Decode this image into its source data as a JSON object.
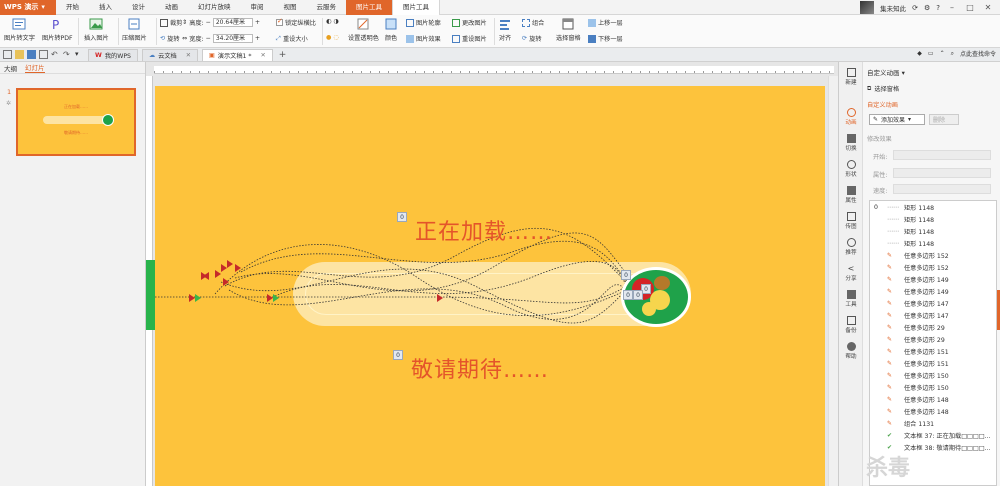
{
  "app": {
    "name": "WPS 演示"
  },
  "menu": {
    "tabs": [
      "开始",
      "插入",
      "设计",
      "动画",
      "幻灯片放映",
      "审阅",
      "视图",
      "云服务",
      "图片工具",
      "图片工具"
    ],
    "user": "集未知此",
    "window_controls": [
      "–",
      "□",
      "✕"
    ]
  },
  "ribbon": {
    "pic_to_text": "图片转文字",
    "pic_to_pdf": "图片转PDF",
    "insert_pic": "插入图片",
    "compress": "压缩图片",
    "crop": "裁剪",
    "rotate": "旋转",
    "height_label": "高度:",
    "height_value": "20.64厘米",
    "width_label": "宽度:",
    "width_value": "34.20厘米",
    "lock_ratio": "锁定纵横比",
    "reset_size": "重设大小",
    "set_transparent": "设置透明色",
    "color": "颜色",
    "pic_outline": "图片轮廓",
    "pic_effect": "图片效果",
    "change_pic": "更改图片",
    "reset_pic": "重设图片",
    "align": "对齐",
    "group": "组合",
    "rotate2": "旋转",
    "select_pane": "选择窗格",
    "bring_forward": "上移一层",
    "send_backward": "下移一层"
  },
  "quickbar": {
    "tabs": [
      {
        "label": "我的WPS"
      },
      {
        "label": "云文档"
      },
      {
        "label": "演示文稿1 *"
      }
    ],
    "find": "点此查找命令"
  },
  "left_pane": {
    "tabs": [
      "大纲",
      "幻灯片"
    ],
    "slide_number": "1",
    "thumb_text1": "正在加载……",
    "thumb_text2": "敬请期待……"
  },
  "slide": {
    "loading_text": "正在加载……",
    "coming_text": "敬请期待……",
    "anim_badge": "0"
  },
  "task_pane": {
    "title": "自定义动画",
    "select_pane": "选择窗格",
    "section": "自定义动画",
    "add_effect": "添加效果",
    "delete": "删除",
    "modify": "修改效果",
    "start_label": "开始:",
    "prop_label": "属性:",
    "speed_label": "速度:",
    "side_icons": [
      "新建",
      "动画",
      "切换",
      "形状",
      "属性",
      "传图",
      "推荐",
      "分享",
      "工具",
      "备份",
      "帮助"
    ],
    "items": [
      {
        "num": "0",
        "type": "line",
        "name": "矩形 1148"
      },
      {
        "num": "",
        "type": "line",
        "name": "矩形 1148"
      },
      {
        "num": "",
        "type": "line",
        "name": "矩形 1148"
      },
      {
        "num": "",
        "type": "line",
        "name": "矩形 1148"
      },
      {
        "num": "",
        "type": "path",
        "name": "任意多边形 152"
      },
      {
        "num": "",
        "type": "path",
        "name": "任意多边形 152"
      },
      {
        "num": "",
        "type": "path",
        "name": "任意多边形 149"
      },
      {
        "num": "",
        "type": "path",
        "name": "任意多边形 149"
      },
      {
        "num": "",
        "type": "path",
        "name": "任意多边形 147"
      },
      {
        "num": "",
        "type": "path",
        "name": "任意多边形 147"
      },
      {
        "num": "",
        "type": "path",
        "name": "任意多边形 29"
      },
      {
        "num": "",
        "type": "path",
        "name": "任意多边形 29"
      },
      {
        "num": "",
        "type": "path",
        "name": "任意多边形 151"
      },
      {
        "num": "",
        "type": "path",
        "name": "任意多边形 151"
      },
      {
        "num": "",
        "type": "path",
        "name": "任意多边形 150"
      },
      {
        "num": "",
        "type": "path",
        "name": "任意多边形 150"
      },
      {
        "num": "",
        "type": "path",
        "name": "任意多边形 148"
      },
      {
        "num": "",
        "type": "path",
        "name": "任意多边形 148"
      },
      {
        "num": "",
        "type": "path",
        "name": "组合 1131"
      },
      {
        "num": "",
        "type": "check",
        "name": "文本框 37: 正在加载□□□□..."
      },
      {
        "num": "",
        "type": "check",
        "name": "文本框 38: 敬请期待□□□□..."
      }
    ]
  },
  "colors": {
    "accent": "#e0662a",
    "slide_bg": "#fdc33c",
    "text_red": "#e4542a",
    "green": "#1fa24a"
  }
}
